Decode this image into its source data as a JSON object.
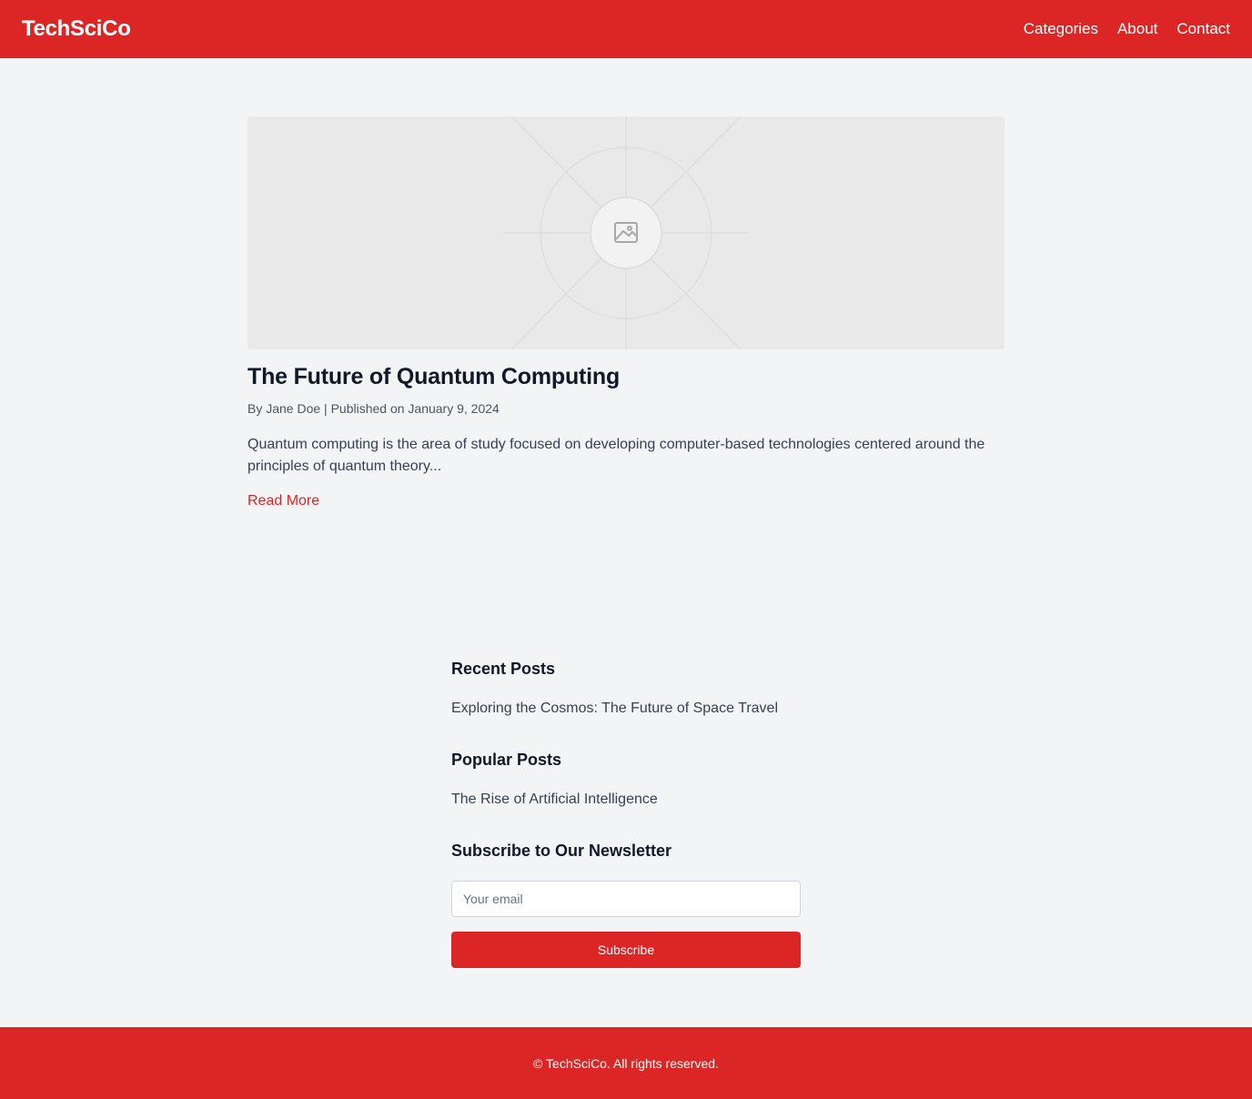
{
  "header": {
    "logo": "TechSciCo",
    "nav": [
      "Categories",
      "About",
      "Contact"
    ]
  },
  "article": {
    "image_icon": "image-placeholder-icon",
    "title": "The Future of Quantum Computing",
    "byline": "By Jane Doe | Published on January 9, 2024",
    "excerpt": "Quantum computing is the area of study focused on developing computer-based technologies centered around the principles of quantum theory...",
    "read_more": "Read More"
  },
  "sidebar": {
    "recent_heading": "Recent Posts",
    "recent_posts": [
      "Exploring the Cosmos: The Future of Space Travel"
    ],
    "popular_heading": "Popular Posts",
    "popular_posts": [
      "The Rise of Artificial Intelligence"
    ],
    "newsletter_heading": "Subscribe to Our Newsletter",
    "email_placeholder": "Your email",
    "subscribe_label": "Subscribe"
  },
  "footer": {
    "text": "© TechSciCo. All rights reserved."
  },
  "colors": {
    "brand": "#dc2626",
    "background": "#f3f4f6"
  }
}
